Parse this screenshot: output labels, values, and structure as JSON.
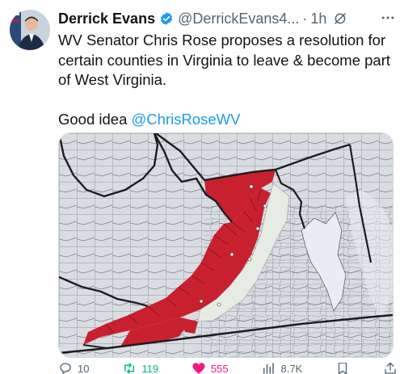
{
  "tweet": {
    "author_name": "Derrick Evans",
    "handle": "@DerrickEvans4...",
    "separator": "·",
    "time": "1h",
    "text_line_1": "WV Senator Chris Rose proposes a resolution for certain counties in Virginia to leave & become part of West Virginia.",
    "text_good_idea": "Good idea ",
    "mention": "@ChrisRoseWV"
  },
  "map": {
    "colors": {
      "counties": "#d9dde2",
      "highlight": "#c8202e",
      "light": "#e6ebe3",
      "borders": "#1c1c1c",
      "water": "#e9edf1"
    }
  },
  "actions": {
    "reply_count": "10",
    "repost_count": "119",
    "like_count": "555",
    "views_count": "8.7K",
    "colors": {
      "repost": "#00ba7c",
      "like": "#f91880"
    }
  }
}
